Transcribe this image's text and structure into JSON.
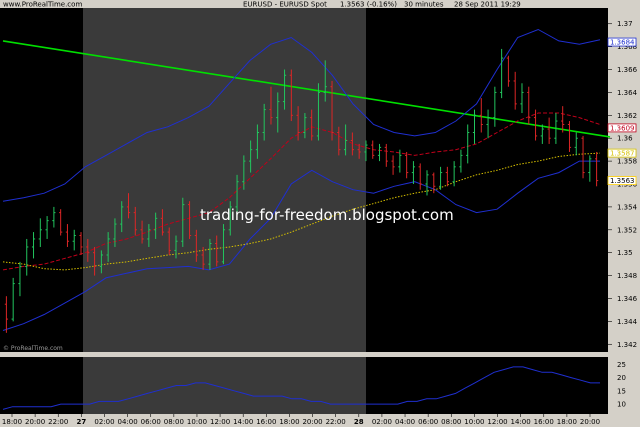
{
  "header": {
    "site": "www.ProRealTime.com",
    "instrument": "EURUSD - EURUSD Spot",
    "change": "1.3563 (-0.16%)",
    "timeframe": "30 minutes",
    "datetime": "28 Sep 2011 19:29"
  },
  "watermark": "trading-for-freedom.blogspot.com",
  "copyright": "© ProRealTime.com",
  "colors": {
    "background": "#000000",
    "session_shade": "#3a3a3a",
    "frame": "#d4d0c8",
    "bull": "#22c55e",
    "bear": "#dc2626",
    "trendline": "#00e000",
    "bollinger": "#1f2fd0",
    "ma_red": "#c0001a",
    "ma_yellow": "#d6c000",
    "indicator": "#1f2fd0"
  },
  "chart_data": [
    {
      "type": "candlestick",
      "title": "EURUSD - EURUSD Spot",
      "ylim": [
        1.3415,
        1.3712
      ],
      "y_ticks": [
        "1.37",
        "1.368",
        "1.366",
        "1.364",
        "1.362",
        "1.36",
        "1.358",
        "1.356",
        "1.354",
        "1.352",
        "1.35",
        "1.348",
        "1.346",
        "1.344",
        "1.342"
      ],
      "x_ticks": [
        "18:00",
        "20:00",
        "22:00",
        "27",
        "02:00",
        "04:00",
        "06:00",
        "08:00",
        "10:00",
        "12:00",
        "14:00",
        "16:00",
        "18:00",
        "20:00",
        "22:00",
        "28",
        "02:00",
        "04:00",
        "06:00",
        "08:00",
        "10:00",
        "12:00",
        "14:00",
        "16:00",
        "18:00",
        "20:00"
      ],
      "price_labels": [
        {
          "value": 1.3684,
          "text": "1.3684",
          "color": "#1f2fd0"
        },
        {
          "value": 1.3609,
          "text": "1.3609",
          "color": "#c0001a"
        },
        {
          "value": 1.3587,
          "text": "1.3587",
          "color": "#d6c000"
        },
        {
          "value": 1.3563,
          "text": "1.3563",
          "color": "#ffd000"
        }
      ],
      "candles": [
        [
          1.3455,
          1.3462,
          1.343,
          1.3442
        ],
        [
          1.3442,
          1.3478,
          1.344,
          1.3473
        ],
        [
          1.3473,
          1.3492,
          1.3462,
          1.3488
        ],
        [
          1.3488,
          1.3512,
          1.348,
          1.3505
        ],
        [
          1.3505,
          1.3518,
          1.3495,
          1.3512
        ],
        [
          1.3512,
          1.353,
          1.3505,
          1.352
        ],
        [
          1.352,
          1.3532,
          1.3512,
          1.3528
        ],
        [
          1.3528,
          1.354,
          1.3522,
          1.3535
        ],
        [
          1.3535,
          1.3538,
          1.3515,
          1.3518
        ],
        [
          1.3518,
          1.3525,
          1.3505,
          1.351
        ],
        [
          1.351,
          1.352,
          1.3502,
          1.3515
        ],
        [
          1.3515,
          1.3518,
          1.3498,
          1.3505
        ],
        [
          1.3505,
          1.3512,
          1.3492,
          1.35
        ],
        [
          1.35,
          1.3505,
          1.348,
          1.3488
        ],
        [
          1.3488,
          1.3502,
          1.3482,
          1.3498
        ],
        [
          1.3498,
          1.3518,
          1.3492,
          1.3512
        ],
        [
          1.3512,
          1.353,
          1.3505,
          1.3525
        ],
        [
          1.3525,
          1.3545,
          1.3518,
          1.354
        ],
        [
          1.354,
          1.3552,
          1.353,
          1.3535
        ],
        [
          1.3535,
          1.354,
          1.3515,
          1.352
        ],
        [
          1.352,
          1.3528,
          1.3508,
          1.3512
        ],
        [
          1.3512,
          1.3525,
          1.3505,
          1.352
        ],
        [
          1.352,
          1.3535,
          1.3512,
          1.353
        ],
        [
          1.353,
          1.3538,
          1.3515,
          1.3518
        ],
        [
          1.3518,
          1.3522,
          1.3498,
          1.3502
        ],
        [
          1.3502,
          1.3515,
          1.3495,
          1.351
        ],
        [
          1.351,
          1.3548,
          1.3505,
          1.3542
        ],
        [
          1.3542,
          1.3545,
          1.3512,
          1.3515
        ],
        [
          1.3515,
          1.352,
          1.3492,
          1.3498
        ],
        [
          1.3498,
          1.3505,
          1.3485,
          1.349
        ],
        [
          1.349,
          1.3512,
          1.3485,
          1.3508
        ],
        [
          1.3508,
          1.3515,
          1.3488,
          1.3492
        ],
        [
          1.3492,
          1.3525,
          1.349,
          1.352
        ],
        [
          1.352,
          1.3545,
          1.3515,
          1.354
        ],
        [
          1.354,
          1.3568,
          1.3535,
          1.3562
        ],
        [
          1.3562,
          1.3585,
          1.3555,
          1.358
        ],
        [
          1.358,
          1.3598,
          1.357,
          1.359
        ],
        [
          1.359,
          1.3612,
          1.3582,
          1.3605
        ],
        [
          1.3605,
          1.363,
          1.3598,
          1.3625
        ],
        [
          1.3625,
          1.3645,
          1.3612,
          1.3618
        ],
        [
          1.3618,
          1.364,
          1.3605,
          1.3632
        ],
        [
          1.3632,
          1.366,
          1.3625,
          1.3655
        ],
        [
          1.3655,
          1.366,
          1.3615,
          1.362
        ],
        [
          1.362,
          1.3628,
          1.3598,
          1.3605
        ],
        [
          1.3605,
          1.3622,
          1.36,
          1.3618
        ],
        [
          1.3618,
          1.3625,
          1.3598,
          1.3602
        ],
        [
          1.3602,
          1.3648,
          1.3598,
          1.364
        ],
        [
          1.364,
          1.3668,
          1.3632,
          1.3645
        ],
        [
          1.3645,
          1.365,
          1.3598,
          1.3605
        ],
        [
          1.3605,
          1.361,
          1.3585,
          1.359
        ],
        [
          1.359,
          1.3612,
          1.3585,
          1.3598
        ],
        [
          1.3598,
          1.3605,
          1.3585,
          1.359
        ],
        [
          1.359,
          1.3595,
          1.3582,
          1.3588
        ],
        [
          1.3588,
          1.3598,
          1.358,
          1.3594
        ],
        [
          1.3594,
          1.3598,
          1.3582,
          1.3585
        ],
        [
          1.3585,
          1.3595,
          1.358,
          1.3592
        ],
        [
          1.3592,
          1.3595,
          1.3575,
          1.358
        ],
        [
          1.358,
          1.3585,
          1.3568,
          1.3575
        ],
        [
          1.3575,
          1.359,
          1.357,
          1.3585
        ],
        [
          1.3585,
          1.3588,
          1.3565,
          1.357
        ],
        [
          1.357,
          1.358,
          1.356,
          1.3575
        ],
        [
          1.3575,
          1.3578,
          1.3555,
          1.356
        ],
        [
          1.356,
          1.3572,
          1.355,
          1.3568
        ],
        [
          1.3568,
          1.357,
          1.3552,
          1.3558
        ],
        [
          1.3558,
          1.3575,
          1.3555,
          1.357
        ],
        [
          1.357,
          1.3575,
          1.3558,
          1.3562
        ],
        [
          1.3562,
          1.358,
          1.3558,
          1.3575
        ],
        [
          1.3575,
          1.359,
          1.357,
          1.3585
        ],
        [
          1.3585,
          1.3612,
          1.3578,
          1.3605
        ],
        [
          1.3605,
          1.3625,
          1.3595,
          1.362
        ],
        [
          1.362,
          1.3635,
          1.3605,
          1.3612
        ],
        [
          1.3612,
          1.3625,
          1.36,
          1.3618
        ],
        [
          1.3618,
          1.3645,
          1.361,
          1.364
        ],
        [
          1.364,
          1.3678,
          1.3635,
          1.367
        ],
        [
          1.367,
          1.3672,
          1.3645,
          1.365
        ],
        [
          1.365,
          1.3658,
          1.3625,
          1.363
        ],
        [
          1.363,
          1.3648,
          1.3622,
          1.364
        ],
        [
          1.364,
          1.3645,
          1.3612,
          1.3618
        ],
        [
          1.3618,
          1.3625,
          1.3598,
          1.3602
        ],
        [
          1.3602,
          1.3612,
          1.3595,
          1.3608
        ],
        [
          1.3608,
          1.3618,
          1.3595,
          1.36
        ],
        [
          1.36,
          1.3622,
          1.3595,
          1.3615
        ],
        [
          1.3615,
          1.3628,
          1.3605,
          1.3612
        ],
        [
          1.3612,
          1.3615,
          1.3588,
          1.3592
        ],
        [
          1.3592,
          1.3605,
          1.3585,
          1.36
        ],
        [
          1.36,
          1.3602,
          1.3565,
          1.357
        ],
        [
          1.357,
          1.3585,
          1.3562,
          1.3582
        ],
        [
          1.3582,
          1.3588,
          1.3558,
          1.3563
        ]
      ],
      "trendline": [
        [
          0,
          1.3685
        ],
        [
          86,
          1.3602
        ]
      ],
      "bollinger_upper": [
        1.3545,
        1.3548,
        1.3552,
        1.356,
        1.3575,
        1.3585,
        1.3595,
        1.3605,
        1.361,
        1.3618,
        1.3628,
        1.3648,
        1.3668,
        1.3682,
        1.3688,
        1.3675,
        1.3655,
        1.363,
        1.3612,
        1.3605,
        1.3602,
        1.3605,
        1.3615,
        1.363,
        1.366,
        1.3688,
        1.3695,
        1.3685,
        1.3682,
        1.3686
      ],
      "bollinger_lower": [
        1.3432,
        1.3438,
        1.3446,
        1.3456,
        1.3466,
        1.3478,
        1.3482,
        1.3486,
        1.3487,
        1.3488,
        1.3485,
        1.349,
        1.3512,
        1.353,
        1.356,
        1.3572,
        1.3562,
        1.3555,
        1.3552,
        1.3558,
        1.3562,
        1.3555,
        1.3542,
        1.3535,
        1.3538,
        1.3552,
        1.3565,
        1.357,
        1.358,
        1.358
      ],
      "ma_red": [
        1.3485,
        1.3488,
        1.349,
        1.3495,
        1.35,
        1.3508,
        1.3512,
        1.3518,
        1.3525,
        1.353,
        1.3535,
        1.3548,
        1.3565,
        1.3582,
        1.36,
        1.361,
        1.3605,
        1.3595,
        1.359,
        1.3588,
        1.3585,
        1.3588,
        1.359,
        1.3595,
        1.3605,
        1.3615,
        1.3622,
        1.3622,
        1.3618,
        1.3612
      ],
      "ma_yellow": [
        1.3492,
        1.349,
        1.3486,
        1.3485,
        1.3487,
        1.349,
        1.3492,
        1.3495,
        1.3498,
        1.35,
        1.3503,
        1.3505,
        1.3508,
        1.3512,
        1.3518,
        1.3525,
        1.3532,
        1.3538,
        1.3543,
        1.3548,
        1.3552,
        1.3555,
        1.3562,
        1.3568,
        1.3572,
        1.3577,
        1.358,
        1.3584,
        1.3586,
        1.3587
      ]
    },
    {
      "type": "line",
      "ylim": [
        7,
        27
      ],
      "y_ticks": [
        "25",
        "20",
        "15",
        "10"
      ],
      "values": [
        8,
        9,
        9,
        9,
        9,
        9,
        10,
        10,
        10,
        10,
        11,
        11,
        11,
        12,
        13,
        14,
        15,
        16,
        17,
        17,
        18,
        18,
        17,
        16,
        15,
        14,
        13,
        13,
        13,
        13,
        12,
        12,
        11,
        11,
        10,
        10,
        10,
        10,
        10,
        10,
        10,
        10,
        11,
        11,
        12,
        12,
        13,
        14,
        16,
        18,
        20,
        22,
        23,
        24,
        24,
        23,
        22,
        22,
        21,
        20,
        19,
        18,
        18
      ]
    }
  ]
}
